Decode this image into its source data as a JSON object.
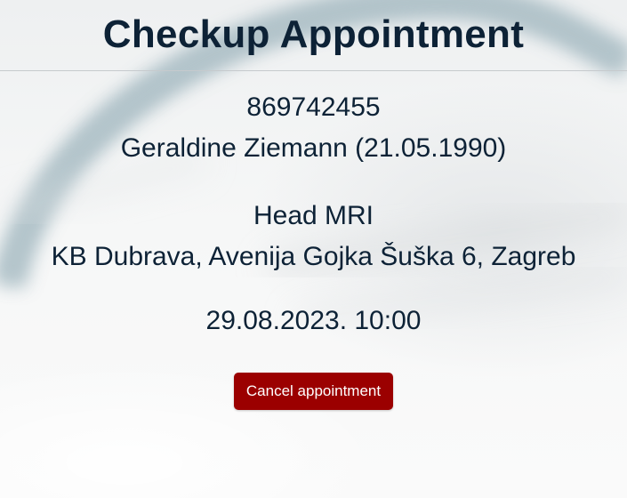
{
  "page": {
    "title": "Checkup Appointment"
  },
  "patient": {
    "id": "869742455",
    "name_and_dob": "Geraldine Ziemann (21.05.1990)"
  },
  "exam": {
    "type": "Head MRI",
    "location": "KB Dubrava, Avenija Gojka Šuška 6, Zagreb"
  },
  "appointment": {
    "datetime": "29.08.2023. 10:00"
  },
  "actions": {
    "cancel_label": "Cancel appointment"
  },
  "colors": {
    "text": "#0d2236",
    "cancel_button": "#9b0000"
  }
}
